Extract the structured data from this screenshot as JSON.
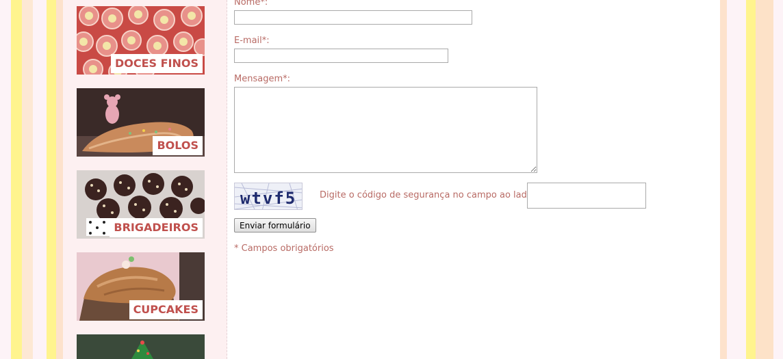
{
  "categories": [
    {
      "label": "DOCES FINOS"
    },
    {
      "label": "BOLOS"
    },
    {
      "label": "BRIGADEIROS"
    },
    {
      "label": "CUPCAKES"
    },
    {
      "label": ""
    }
  ],
  "form": {
    "name_label": "Nome*:",
    "email_label": "E-mail*:",
    "message_label": "Mensagem*:",
    "name_value": "",
    "email_value": "",
    "message_value": "",
    "captcha_code": "wtvf5",
    "captcha_hint": "Digite o código de segurança no campo ao lado",
    "captcha_value": "",
    "submit_label": "Enviar formulário",
    "required_note": "* Campos obrigatórios"
  },
  "colors": {
    "accent_text": "#b86a64",
    "caption_text": "#c0504d",
    "stripe_yellow": "#fff0a0",
    "stripe_peach": "#fde2c8"
  }
}
